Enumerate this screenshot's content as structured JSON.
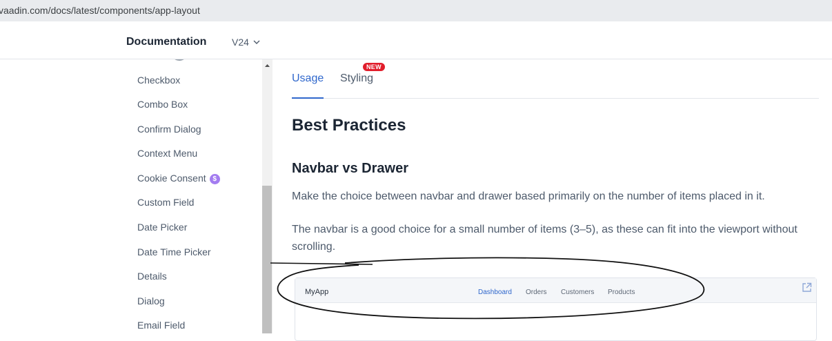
{
  "browser": {
    "url": "vaadin.com/docs/latest/components/app-layout"
  },
  "header": {
    "title": "Documentation",
    "version": "V24"
  },
  "sidebar": {
    "items": [
      {
        "label": "Checkbox"
      },
      {
        "label": "Combo Box"
      },
      {
        "label": "Confirm Dialog"
      },
      {
        "label": "Context Menu"
      },
      {
        "label": "Cookie Consent",
        "badge": "$"
      },
      {
        "label": "Custom Field"
      },
      {
        "label": "Date Picker"
      },
      {
        "label": "Date Time Picker"
      },
      {
        "label": "Details"
      },
      {
        "label": "Dialog"
      },
      {
        "label": "Email Field"
      }
    ]
  },
  "tabs": [
    {
      "label": "Usage",
      "active": true
    },
    {
      "label": "Styling",
      "badge": "NEW"
    }
  ],
  "content": {
    "heading": "Best Practices",
    "subheading": "Navbar vs Drawer",
    "paragraph1": "Make the choice between navbar and drawer based primarily on the number of items placed in it.",
    "paragraph2": "The navbar is a good choice for a small number of items (3–5), as these can fit into the viewport without scrolling."
  },
  "preview": {
    "app_name": "MyApp",
    "nav": [
      {
        "label": "Dashboard",
        "active": true
      },
      {
        "label": "Orders"
      },
      {
        "label": "Customers"
      },
      {
        "label": "Products"
      }
    ]
  },
  "colors": {
    "accent": "#2f67cc",
    "badge_new": "#e11d2b",
    "badge_dollar": "#a37cf0"
  }
}
